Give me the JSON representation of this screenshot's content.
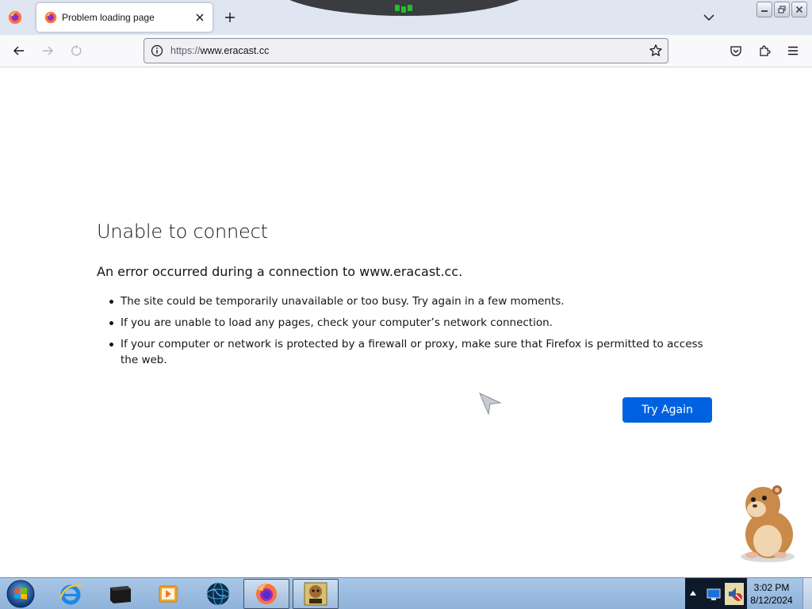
{
  "browser": {
    "tab_title": "Problem loading page",
    "url_protocol": "https://",
    "url_host": "www.eracast.cc",
    "accent_color": "#0061e0"
  },
  "error_page": {
    "title": "Unable to connect",
    "description": "An error occurred during a connection to www.eracast.cc.",
    "suggestions": [
      "The site could be temporarily unavailable or too busy. Try again in a few moments.",
      "If you are unable to load any pages, check your computer’s network connection.",
      "If your computer or network is protected by a firewall or proxy, make sure that Firefox is permitted to access the web."
    ],
    "try_again_label": "Try Again"
  },
  "taskbar": {
    "items": [
      "start-orb",
      "internet-explorer-icon",
      "terminal-icon",
      "media-player-icon",
      "globe-icon",
      "firefox-icon",
      "box-app-icon"
    ],
    "clock_time": "3:02 PM",
    "clock_date": "8/12/2024"
  }
}
